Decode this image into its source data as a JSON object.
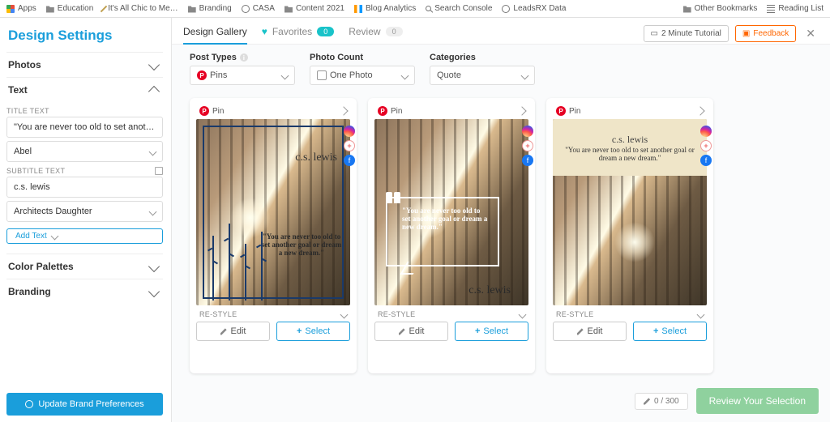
{
  "bookmarks": {
    "left": [
      {
        "icon": "apps",
        "label": "Apps"
      },
      {
        "icon": "folder",
        "label": "Education"
      },
      {
        "icon": "pen",
        "label": "It's All Chic to Me…"
      },
      {
        "icon": "folder",
        "label": "Branding"
      },
      {
        "icon": "globe",
        "label": "CASA"
      },
      {
        "icon": "folder",
        "label": "Content 2021"
      },
      {
        "icon": "chart",
        "label": "Blog Analytics"
      },
      {
        "icon": "mag",
        "label": "Search Console"
      },
      {
        "icon": "globe",
        "label": "LeadsRX Data"
      }
    ],
    "right": [
      {
        "icon": "folder",
        "label": "Other Bookmarks"
      },
      {
        "icon": "list",
        "label": "Reading List"
      }
    ]
  },
  "sidebar": {
    "title": "Design Settings",
    "sections": {
      "photos": "Photos",
      "text": "Text",
      "palettes": "Color Palettes",
      "branding": "Branding"
    },
    "title_text_label": "TITLE TEXT",
    "title_text_value": "\"You are never too old to set another goal or dream a new dream.\"",
    "title_font": "Abel",
    "subtitle_label": "SUBTITLE TEXT",
    "subtitle_value": "c.s. lewis",
    "subtitle_font": "Architects Daughter",
    "add_text": "Add Text",
    "update_btn": "Update Brand Preferences"
  },
  "tabs": {
    "gallery": "Design Gallery",
    "favorites": "Favorites",
    "fav_count": "0",
    "review": "Review",
    "review_count": "0"
  },
  "top_actions": {
    "tutorial": "2 Minute Tutorial",
    "feedback": "Feedback"
  },
  "filters": {
    "post_types_label": "Post Types",
    "post_types_value": "Pins",
    "photo_count_label": "Photo Count",
    "photo_count_value": "One Photo",
    "categories_label": "Categories",
    "categories_value": "Quote"
  },
  "cards": [
    {
      "pin": "Pin",
      "author": "c.s. lewis",
      "quote": "\"You are never too old to set another goal or dream a new dream.\"",
      "restyle": "RE-STYLE",
      "edit": "Edit",
      "select": "Select"
    },
    {
      "pin": "Pin",
      "author": "c.s. lewis",
      "quote": "\"You are never too old to set another goal or dream a new dream.\"",
      "restyle": "RE-STYLE",
      "edit": "Edit",
      "select": "Select"
    },
    {
      "pin": "Pin",
      "author": "c.s. lewis",
      "quote": "\"You are never too old to set another goal or dream a new dream.\"",
      "restyle": "RE-STYLE",
      "edit": "Edit",
      "select": "Select"
    }
  ],
  "footer": {
    "counter": "0 / 300",
    "review": "Review Your Selection"
  }
}
